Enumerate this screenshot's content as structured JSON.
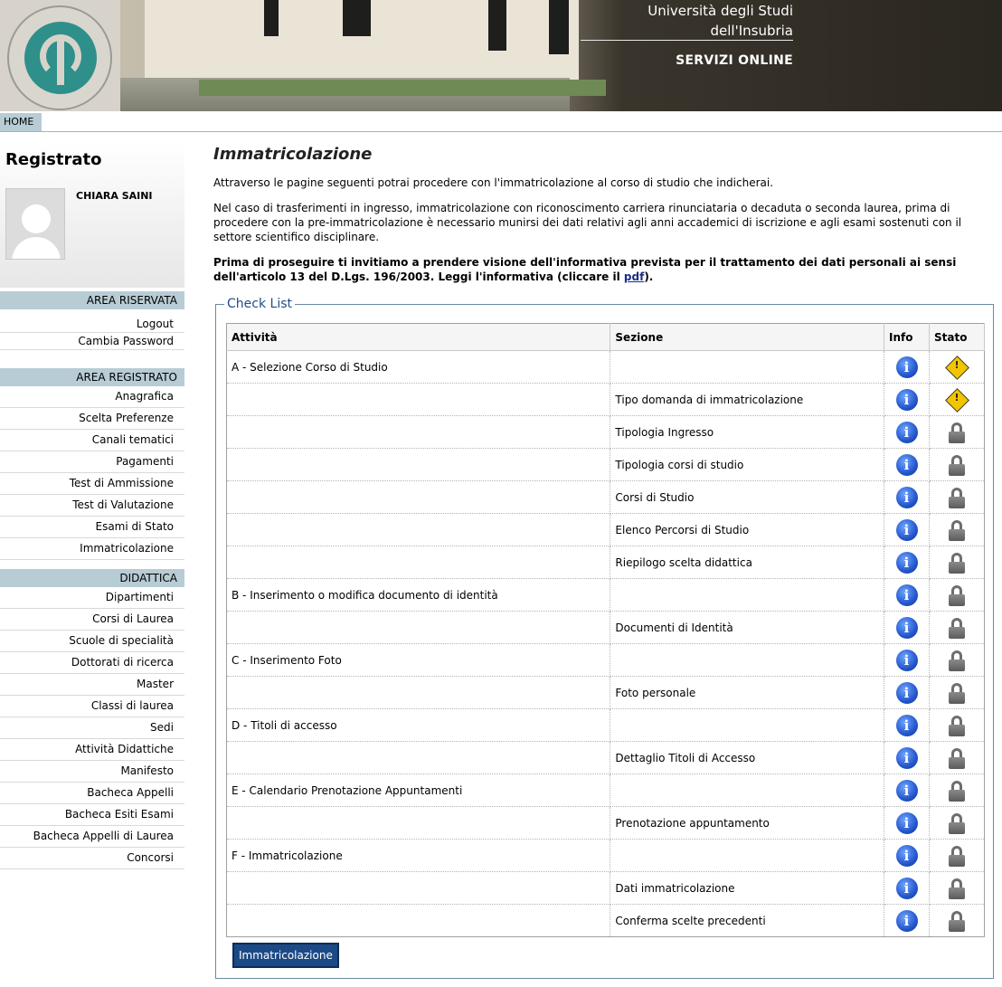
{
  "header": {
    "university_line1": "Università degli Studi",
    "university_line2": "dell'Insubria",
    "services": "SERVIZI ONLINE"
  },
  "tabs": {
    "home": "HOME"
  },
  "user": {
    "status": "Registrato",
    "name": "CHIARA SAINI"
  },
  "sidebar": {
    "area_riservata": {
      "title": "AREA RISERVATA",
      "items": [
        "Logout",
        "Cambia Password"
      ]
    },
    "area_registrato": {
      "title": "AREA REGISTRATO",
      "items": [
        "Anagrafica",
        "Scelta Preferenze",
        "Canali tematici",
        "Pagamenti",
        "Test di Ammissione",
        "Test di Valutazione",
        "Esami di Stato",
        "Immatricolazione"
      ]
    },
    "didattica": {
      "title": "DIDATTICA",
      "items": [
        "Dipartimenti",
        "Corsi di Laurea",
        "Scuole di specialità",
        "Dottorati di ricerca",
        "Master",
        "Classi di laurea",
        "Sedi",
        "Attività Didattiche",
        "Manifesto",
        "Bacheca Appelli",
        "Bacheca Esiti Esami",
        "Bacheca Appelli di Laurea",
        "Concorsi"
      ]
    }
  },
  "main": {
    "title": "Immatricolazione",
    "intro": "Attraverso le pagine seguenti potrai procedere con l'immatricolazione al corso di studio che indicherai.",
    "note": "Nel caso di trasferimenti in ingresso, immatricolazione con riconoscimento carriera rinunciataria o decaduta o seconda laurea, prima di procedere con la pre-immatricolazione è necessario munirsi dei dati relativi agli anni accademici di iscrizione e agli esami sostenuti con il settore scientifico disciplinare.",
    "privacy_before": "Prima di proseguire ti invitiamo a prendere visione dell'informativa prevista per il trattamento dei dati personali ai sensi dell'articolo 13 del D.Lgs. 196/2003. Leggi l'informativa (cliccare il ",
    "privacy_link": "pdf",
    "privacy_after": ").",
    "checklist_legend": "Check List",
    "columns": {
      "attivita": "Attività",
      "sezione": "Sezione",
      "info": "Info",
      "stato": "Stato"
    },
    "rows": [
      {
        "attivita": "A - Selezione Corso di Studio",
        "sezione": "",
        "stato": "warning"
      },
      {
        "attivita": "",
        "sezione": "Tipo domanda di immatricolazione",
        "stato": "warning"
      },
      {
        "attivita": "",
        "sezione": "Tipologia Ingresso",
        "stato": "locked"
      },
      {
        "attivita": "",
        "sezione": "Tipologia corsi di studio",
        "stato": "locked"
      },
      {
        "attivita": "",
        "sezione": "Corsi di Studio",
        "stato": "locked"
      },
      {
        "attivita": "",
        "sezione": "Elenco Percorsi di Studio",
        "stato": "locked"
      },
      {
        "attivita": "",
        "sezione": "Riepilogo scelta didattica",
        "stato": "locked"
      },
      {
        "attivita": "B - Inserimento o modifica documento di identità",
        "sezione": "",
        "stato": "locked"
      },
      {
        "attivita": "",
        "sezione": "Documenti di Identità",
        "stato": "locked"
      },
      {
        "attivita": "C - Inserimento Foto",
        "sezione": "",
        "stato": "locked"
      },
      {
        "attivita": "",
        "sezione": "Foto personale",
        "stato": "locked"
      },
      {
        "attivita": "D - Titoli di accesso",
        "sezione": "",
        "stato": "locked"
      },
      {
        "attivita": "",
        "sezione": "Dettaglio Titoli di Accesso",
        "stato": "locked"
      },
      {
        "attivita": "E - Calendario Prenotazione Appuntamenti",
        "sezione": "",
        "stato": "locked"
      },
      {
        "attivita": "",
        "sezione": "Prenotazione appuntamento",
        "stato": "locked"
      },
      {
        "attivita": "F - Immatricolazione",
        "sezione": "",
        "stato": "locked"
      },
      {
        "attivita": "",
        "sezione": "Dati immatricolazione",
        "stato": "locked"
      },
      {
        "attivita": "",
        "sezione": "Conferma scelte precedenti",
        "stato": "locked"
      }
    ],
    "button_label": "Immatricolazione"
  },
  "icons": {
    "info": "info-icon",
    "warning": "warning-icon",
    "locked": "lock-icon"
  },
  "colors": {
    "nav_header": "#b8ccd5",
    "button": "#1c4a86",
    "link": "#1a2c8a",
    "legend": "#1f4d8c"
  }
}
